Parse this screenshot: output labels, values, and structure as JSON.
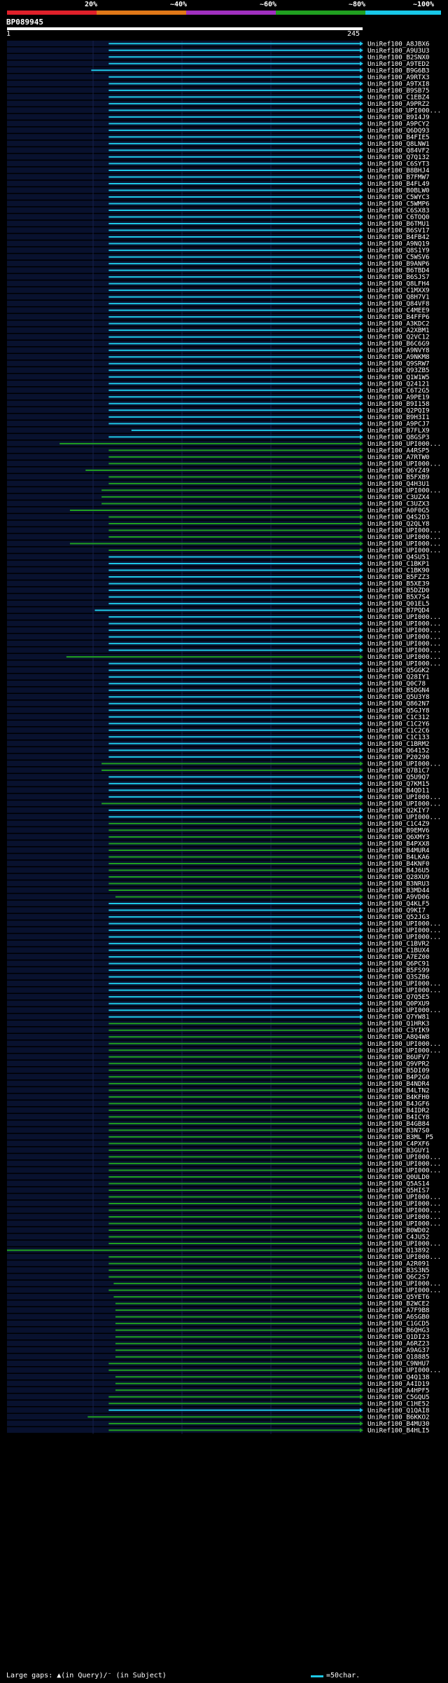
{
  "legend": {
    "labels": [
      "20%",
      "~40%",
      "~60%",
      "~80%",
      "~100%"
    ],
    "colors": [
      "#e0202a",
      "#e07818",
      "#a030c0",
      "#20a020",
      "#18c8e8"
    ]
  },
  "query": {
    "name": "BP089945",
    "start": "1",
    "end": "245"
  },
  "footer": {
    "gaps": "Large gaps: ▲(in Query)/⁻ (in Subject)",
    "key": "=50char."
  },
  "colors": {
    "cyan": "#1ec8e6",
    "green": "#20a020",
    "grid": "#16204a",
    "row": "#08112e"
  },
  "hits": [
    {
      "label": "UniRef100_A8JBX6",
      "color": "cyan",
      "start": 0.286
    },
    {
      "label": "UniRef100_A9U3U3",
      "color": "cyan",
      "start": 0.286
    },
    {
      "label": "UniRef100_B2SNX0",
      "color": "cyan",
      "start": 0.286
    },
    {
      "label": "UniRef100_A9TED2",
      "color": "cyan",
      "start": 0.286
    },
    {
      "label": "UniRef100_B9G6B3",
      "color": "cyan",
      "start": 0.237
    },
    {
      "label": "UniRef100_A9RTX3",
      "color": "cyan",
      "start": 0.286
    },
    {
      "label": "UniRef100_A9TXI8",
      "color": "cyan",
      "start": 0.286
    },
    {
      "label": "UniRef100_B9SB75",
      "color": "cyan",
      "start": 0.286
    },
    {
      "label": "UniRef100_C1EBZ4",
      "color": "cyan",
      "start": 0.286
    },
    {
      "label": "UniRef100_A9PRZ2",
      "color": "cyan",
      "start": 0.286
    },
    {
      "label": "UniRef100_UPI000...",
      "color": "cyan",
      "start": 0.286
    },
    {
      "label": "UniRef100_B9I4J9",
      "color": "cyan",
      "start": 0.286
    },
    {
      "label": "UniRef100_A9PCY2",
      "color": "cyan",
      "start": 0.286
    },
    {
      "label": "UniRef100_Q6DQ93",
      "color": "cyan",
      "start": 0.286
    },
    {
      "label": "UniRef100_B4FIE5",
      "color": "cyan",
      "start": 0.286
    },
    {
      "label": "UniRef100_Q8LNW1",
      "color": "cyan",
      "start": 0.286
    },
    {
      "label": "UniRef100_Q84VF2",
      "color": "cyan",
      "start": 0.286
    },
    {
      "label": "UniRef100_Q7Q132",
      "color": "cyan",
      "start": 0.286
    },
    {
      "label": "UniRef100_C6SYT3",
      "color": "cyan",
      "start": 0.286
    },
    {
      "label": "UniRef100_B8BHJ4",
      "color": "cyan",
      "start": 0.286
    },
    {
      "label": "UniRef100_B7FMW7",
      "color": "cyan",
      "start": 0.286
    },
    {
      "label": "UniRef100_B4FL49",
      "color": "cyan",
      "start": 0.286
    },
    {
      "label": "UniRef100_B0BLW0",
      "color": "cyan",
      "start": 0.286
    },
    {
      "label": "UniRef100_C5WYC3",
      "color": "cyan",
      "start": 0.286
    },
    {
      "label": "UniRef100_C5WMP6",
      "color": "cyan",
      "start": 0.286
    },
    {
      "label": "UniRef100_C6SX83",
      "color": "cyan",
      "start": 0.286
    },
    {
      "label": "UniRef100_C6TOQ0",
      "color": "cyan",
      "start": 0.286
    },
    {
      "label": "UniRef100_B6TMU1",
      "color": "cyan",
      "start": 0.286
    },
    {
      "label": "UniRef100_B6SV17",
      "color": "cyan",
      "start": 0.286
    },
    {
      "label": "UniRef100_B4FB42",
      "color": "cyan",
      "start": 0.286
    },
    {
      "label": "UniRef100_A9NQ19",
      "color": "cyan",
      "start": 0.286
    },
    {
      "label": "UniRef100_Q8S1Y9",
      "color": "cyan",
      "start": 0.286
    },
    {
      "label": "UniRef100_C5WSV6",
      "color": "cyan",
      "start": 0.286
    },
    {
      "label": "UniRef100_B9ANP6",
      "color": "cyan",
      "start": 0.286
    },
    {
      "label": "UniRef100_B6TBD4",
      "color": "cyan",
      "start": 0.286
    },
    {
      "label": "UniRef100_B6SJS7",
      "color": "cyan",
      "start": 0.286
    },
    {
      "label": "UniRef100_Q8LFH4",
      "color": "cyan",
      "start": 0.286
    },
    {
      "label": "UniRef100_C1MXX9",
      "color": "cyan",
      "start": 0.286
    },
    {
      "label": "UniRef100_Q8H7V1",
      "color": "cyan",
      "start": 0.286
    },
    {
      "label": "UniRef100_Q84VF8",
      "color": "cyan",
      "start": 0.286
    },
    {
      "label": "UniRef100_C4MEE9",
      "color": "cyan",
      "start": 0.286
    },
    {
      "label": "UniRef100_B4FFP6",
      "color": "cyan",
      "start": 0.286
    },
    {
      "label": "UniRef100_A3KDC2",
      "color": "cyan",
      "start": 0.286
    },
    {
      "label": "UniRef100_A2XBM1",
      "color": "cyan",
      "start": 0.286
    },
    {
      "label": "UniRef100_Q2VC12",
      "color": "cyan",
      "start": 0.286
    },
    {
      "label": "UniRef100_B6C6G9",
      "color": "cyan",
      "start": 0.286
    },
    {
      "label": "UniRef100_A9NVY8",
      "color": "cyan",
      "start": 0.286
    },
    {
      "label": "UniRef100_A9NKM8",
      "color": "cyan",
      "start": 0.286
    },
    {
      "label": "UniRef100_Q9SRW7",
      "color": "cyan",
      "start": 0.286
    },
    {
      "label": "UniRef100_Q93ZB5",
      "color": "cyan",
      "start": 0.286
    },
    {
      "label": "UniRef100_Q1W1W5",
      "color": "cyan",
      "start": 0.286
    },
    {
      "label": "UniRef100_Q24121",
      "color": "cyan",
      "start": 0.286
    },
    {
      "label": "UniRef100_C6T2G5",
      "color": "cyan",
      "start": 0.286
    },
    {
      "label": "UniRef100_A9PE19",
      "color": "cyan",
      "start": 0.286
    },
    {
      "label": "UniRef100_B9I158",
      "color": "cyan",
      "start": 0.286
    },
    {
      "label": "UniRef100_Q2PQI9",
      "color": "cyan",
      "start": 0.286
    },
    {
      "label": "UniRef100_B9H3I1",
      "color": "cyan",
      "start": 0.286
    },
    {
      "label": "UniRef100_A9PCJ7",
      "color": "cyan",
      "start": 0.286
    },
    {
      "label": "UniRef100_B7FLX9",
      "color": "cyan",
      "start": 0.35
    },
    {
      "label": "UniRef100_Q8GSP3",
      "color": "cyan",
      "start": 0.286
    },
    {
      "label": "UniRef100_UPI000...",
      "color": "green",
      "start": 0.148
    },
    {
      "label": "UniRef100_A4RSP5",
      "color": "green",
      "start": 0.286
    },
    {
      "label": "UniRef100_A7RTW0",
      "color": "green",
      "start": 0.286
    },
    {
      "label": "UniRef100_UPI000...",
      "color": "green",
      "start": 0.286
    },
    {
      "label": "UniRef100_Q6YZ49",
      "color": "green",
      "start": 0.221
    },
    {
      "label": "UniRef100_B5FXB9",
      "color": "green",
      "start": 0.286
    },
    {
      "label": "UniRef100_Q4H3U1",
      "color": "green",
      "start": 0.286
    },
    {
      "label": "UniRef100_UPI000...",
      "color": "green",
      "start": 0.266
    },
    {
      "label": "UniRef100_C3UZX4",
      "color": "green",
      "start": 0.266
    },
    {
      "label": "UniRef100_C3UZX3",
      "color": "green",
      "start": 0.266
    },
    {
      "label": "UniRef100_A0F0G5",
      "color": "green",
      "start": 0.177
    },
    {
      "label": "UniRef100_Q4S2D3",
      "color": "green",
      "start": 0.286
    },
    {
      "label": "UniRef100_Q2QLY8",
      "color": "green",
      "start": 0.286
    },
    {
      "label": "UniRef100_UPI000...",
      "color": "green",
      "start": 0.286
    },
    {
      "label": "UniRef100_UPI000...",
      "color": "green",
      "start": 0.286
    },
    {
      "label": "UniRef100_UPI000...",
      "color": "green",
      "start": 0.177
    },
    {
      "label": "UniRef100_UPI000...",
      "color": "green",
      "start": 0.286
    },
    {
      "label": "UniRef100_Q4SU51",
      "color": "cyan",
      "start": 0.286
    },
    {
      "label": "UniRef100_C1BKP1",
      "color": "cyan",
      "start": 0.286
    },
    {
      "label": "UniRef100_C1BK90",
      "color": "cyan",
      "start": 0.286
    },
    {
      "label": "UniRef100_B5FZZ3",
      "color": "cyan",
      "start": 0.286
    },
    {
      "label": "UniRef100_B5XE39",
      "color": "cyan",
      "start": 0.286
    },
    {
      "label": "UniRef100_B5DZD0",
      "color": "cyan",
      "start": 0.286
    },
    {
      "label": "UniRef100_B5X7S4",
      "color": "cyan",
      "start": 0.286
    },
    {
      "label": "UniRef100_Q01EL5",
      "color": "cyan",
      "start": 0.286
    },
    {
      "label": "UniRef100_B7PQD4",
      "color": "cyan",
      "start": 0.247
    },
    {
      "label": "UniRef100_UPI000...",
      "color": "cyan",
      "start": 0.286
    },
    {
      "label": "UniRef100_UPI000...",
      "color": "cyan",
      "start": 0.286
    },
    {
      "label": "UniRef100_UPI000...",
      "color": "cyan",
      "start": 0.286
    },
    {
      "label": "UniRef100_UPI000...",
      "color": "cyan",
      "start": 0.286
    },
    {
      "label": "UniRef100_UPI000...",
      "color": "cyan",
      "start": 0.286
    },
    {
      "label": "UniRef100_UPI000...",
      "color": "cyan",
      "start": 0.286
    },
    {
      "label": "UniRef100_UPI000...",
      "color": "green",
      "start": 0.167
    },
    {
      "label": "UniRef100_UPI000...",
      "color": "cyan",
      "start": 0.286
    },
    {
      "label": "UniRef100_Q5GGK2",
      "color": "cyan",
      "start": 0.286
    },
    {
      "label": "UniRef100_Q28IY1",
      "color": "cyan",
      "start": 0.286
    },
    {
      "label": "UniRef100_Q0C78",
      "color": "cyan",
      "start": 0.286
    },
    {
      "label": "UniRef100_B5DGN4",
      "color": "cyan",
      "start": 0.286
    },
    {
      "label": "UniRef100_Q5U3Y8",
      "color": "cyan",
      "start": 0.286
    },
    {
      "label": "UniRef100_Q862N7",
      "color": "cyan",
      "start": 0.286
    },
    {
      "label": "UniRef100_Q5GJY8",
      "color": "cyan",
      "start": 0.286
    },
    {
      "label": "UniRef100_C1C312",
      "color": "cyan",
      "start": 0.286
    },
    {
      "label": "UniRef100_C1C2Y6",
      "color": "cyan",
      "start": 0.286
    },
    {
      "label": "UniRef100_C1C2C6",
      "color": "cyan",
      "start": 0.286
    },
    {
      "label": "UniRef100_C1C133",
      "color": "cyan",
      "start": 0.286
    },
    {
      "label": "UniRef100_C1BRM2",
      "color": "cyan",
      "start": 0.286
    },
    {
      "label": "UniRef100_Q64152",
      "color": "cyan",
      "start": 0.286
    },
    {
      "label": "UniRef100_P20290",
      "color": "cyan",
      "start": 0.286
    },
    {
      "label": "UniRef100_UPI000...",
      "color": "green",
      "start": 0.266
    },
    {
      "label": "UniRef100_Q7B1C7",
      "color": "green",
      "start": 0.266
    },
    {
      "label": "UniRef100_Q5U9Q7",
      "color": "cyan",
      "start": 0.286
    },
    {
      "label": "UniRef100_Q7KM15",
      "color": "cyan",
      "start": 0.286
    },
    {
      "label": "UniRef100_B4QD11",
      "color": "cyan",
      "start": 0.286
    },
    {
      "label": "UniRef100_UPI000...",
      "color": "cyan",
      "start": 0.286
    },
    {
      "label": "UniRef100_UPI000...",
      "color": "green",
      "start": 0.266
    },
    {
      "label": "UniRef100_Q2KIY7",
      "color": "cyan",
      "start": 0.286
    },
    {
      "label": "UniRef100_UPI000...",
      "color": "cyan",
      "start": 0.286
    },
    {
      "label": "UniRef100_C1C4Z9",
      "color": "green",
      "start": 0.286
    },
    {
      "label": "UniRef100_B9EMV6",
      "color": "green",
      "start": 0.286
    },
    {
      "label": "UniRef100_Q6XMY3",
      "color": "green",
      "start": 0.286
    },
    {
      "label": "UniRef100_B4PXX8",
      "color": "green",
      "start": 0.286
    },
    {
      "label": "UniRef100_B4MUR4",
      "color": "green",
      "start": 0.286
    },
    {
      "label": "UniRef100_B4LKA6",
      "color": "green",
      "start": 0.286
    },
    {
      "label": "UniRef100_B4KNF0",
      "color": "green",
      "start": 0.286
    },
    {
      "label": "UniRef100_B4J6U5",
      "color": "green",
      "start": 0.286
    },
    {
      "label": "UniRef100_Q28XU9",
      "color": "green",
      "start": 0.286
    },
    {
      "label": "UniRef100_B3NRU3",
      "color": "green",
      "start": 0.286
    },
    {
      "label": "UniRef100_B3MD44",
      "color": "green",
      "start": 0.286
    },
    {
      "label": "UniRef100_A9VD06",
      "color": "green",
      "start": 0.305
    },
    {
      "label": "UniRef100_Q4KLF5",
      "color": "cyan",
      "start": 0.286
    },
    {
      "label": "UniRef100_Q9KI7",
      "color": "cyan",
      "start": 0.286
    },
    {
      "label": "UniRef100_Q52JG3",
      "color": "cyan",
      "start": 0.286
    },
    {
      "label": "UniRef100_UPI000...",
      "color": "cyan",
      "start": 0.286
    },
    {
      "label": "UniRef100_UPI000...",
      "color": "cyan",
      "start": 0.286
    },
    {
      "label": "UniRef100_UPI000...",
      "color": "cyan",
      "start": 0.286
    },
    {
      "label": "UniRef100_C1BVR2",
      "color": "cyan",
      "start": 0.286
    },
    {
      "label": "UniRef100_C1BUX4",
      "color": "cyan",
      "start": 0.286
    },
    {
      "label": "UniRef100_A7EZ00",
      "color": "cyan",
      "start": 0.286
    },
    {
      "label": "UniRef100_Q6PC91",
      "color": "cyan",
      "start": 0.286
    },
    {
      "label": "UniRef100_B5FS99",
      "color": "cyan",
      "start": 0.286
    },
    {
      "label": "UniRef100_Q3SZB6",
      "color": "cyan",
      "start": 0.286
    },
    {
      "label": "UniRef100_UPI000...",
      "color": "cyan",
      "start": 0.286
    },
    {
      "label": "UniRef100_UPI000...",
      "color": "cyan",
      "start": 0.286
    },
    {
      "label": "UniRef100_Q7Q5E5",
      "color": "cyan",
      "start": 0.286
    },
    {
      "label": "UniRef100_Q0PXU9",
      "color": "cyan",
      "start": 0.286
    },
    {
      "label": "UniRef100_UPI000...",
      "color": "cyan",
      "start": 0.286
    },
    {
      "label": "UniRef100_Q7YW81",
      "color": "cyan",
      "start": 0.286
    },
    {
      "label": "UniRef100_Q1HRK3",
      "color": "green",
      "start": 0.286
    },
    {
      "label": "UniRef100_C3YIK9",
      "color": "green",
      "start": 0.286
    },
    {
      "label": "UniRef100_A8Q4W8",
      "color": "green",
      "start": 0.286
    },
    {
      "label": "UniRef100_UPI000...",
      "color": "green",
      "start": 0.286
    },
    {
      "label": "UniRef100_UPI000...",
      "color": "green",
      "start": 0.286
    },
    {
      "label": "UniRef100_B6UFV7",
      "color": "green",
      "start": 0.286
    },
    {
      "label": "UniRef100_Q9VPR2",
      "color": "green",
      "start": 0.286
    },
    {
      "label": "UniRef100_B5DI09",
      "color": "green",
      "start": 0.286
    },
    {
      "label": "UniRef100_B4P2G0",
      "color": "green",
      "start": 0.286
    },
    {
      "label": "UniRef100_B4NDR4",
      "color": "green",
      "start": 0.286
    },
    {
      "label": "UniRef100_B4LTN2",
      "color": "green",
      "start": 0.286
    },
    {
      "label": "UniRef100_B4KFH0",
      "color": "green",
      "start": 0.286
    },
    {
      "label": "UniRef100_B4JGF6",
      "color": "green",
      "start": 0.286
    },
    {
      "label": "UniRef100_B4IDR2",
      "color": "green",
      "start": 0.286
    },
    {
      "label": "UniRef100_B4ICY8",
      "color": "green",
      "start": 0.286
    },
    {
      "label": "UniRef100_B4GB84",
      "color": "green",
      "start": 0.286
    },
    {
      "label": "UniRef100_B3N7S0",
      "color": "green",
      "start": 0.286
    },
    {
      "label": "UniRef100_B3ML P5",
      "color": "green",
      "start": 0.286
    },
    {
      "label": "UniRef100_C4PXF6",
      "color": "green",
      "start": 0.286
    },
    {
      "label": "UniRef100_B3GUY1",
      "color": "green",
      "start": 0.286
    },
    {
      "label": "UniRef100_UPI000...",
      "color": "green",
      "start": 0.286
    },
    {
      "label": "UniRef100_UPI000...",
      "color": "green",
      "start": 0.286
    },
    {
      "label": "UniRef100_UPI000...",
      "color": "green",
      "start": 0.286
    },
    {
      "label": "UniRef100_Q0ULD0",
      "color": "green",
      "start": 0.286
    },
    {
      "label": "UniRef100_Q5AS14",
      "color": "green",
      "start": 0.286
    },
    {
      "label": "UniRef100_Q5HIS7",
      "color": "green",
      "start": 0.286
    },
    {
      "label": "UniRef100_UPI000...",
      "color": "green",
      "start": 0.286
    },
    {
      "label": "UniRef100_UPI000...",
      "color": "green",
      "start": 0.286
    },
    {
      "label": "UniRef100_UPI000...",
      "color": "green",
      "start": 0.286
    },
    {
      "label": "UniRef100_UPI000...",
      "color": "green",
      "start": 0.286
    },
    {
      "label": "UniRef100_UPI000...",
      "color": "green",
      "start": 0.286
    },
    {
      "label": "UniRef100_B0WD02",
      "color": "green",
      "start": 0.286
    },
    {
      "label": "UniRef100_C4JU52",
      "color": "green",
      "start": 0.286
    },
    {
      "label": "UniRef100_UPI000...",
      "color": "green",
      "start": 0.286
    },
    {
      "label": "UniRef100_Q13892",
      "color": "green",
      "start": 0.0
    },
    {
      "label": "UniRef100_UPI000...",
      "color": "green",
      "start": 0.286
    },
    {
      "label": "UniRef100_A2R091",
      "color": "green",
      "start": 0.286
    },
    {
      "label": "UniRef100_B3S3N5",
      "color": "green",
      "start": 0.286
    },
    {
      "label": "UniRef100_Q6C2S7",
      "color": "green",
      "start": 0.286
    },
    {
      "label": "UniRef100_UPI000...",
      "color": "green",
      "start": 0.3
    },
    {
      "label": "UniRef100_UPI000...",
      "color": "green",
      "start": 0.286
    },
    {
      "label": "UniRef100_Q5YET6",
      "color": "green",
      "start": 0.3
    },
    {
      "label": "UniRef100_B2WCE2",
      "color": "green",
      "start": 0.305
    },
    {
      "label": "UniRef100_A7F9B8",
      "color": "green",
      "start": 0.305
    },
    {
      "label": "UniRef100_A6SGB0",
      "color": "green",
      "start": 0.305
    },
    {
      "label": "UniRef100_C1GCD5",
      "color": "green",
      "start": 0.305
    },
    {
      "label": "UniRef100_B6QHG3",
      "color": "green",
      "start": 0.305
    },
    {
      "label": "UniRef100_Q1DI23",
      "color": "green",
      "start": 0.305
    },
    {
      "label": "UniRef100_A6RZ23",
      "color": "green",
      "start": 0.305
    },
    {
      "label": "UniRef100_A9AG37",
      "color": "green",
      "start": 0.305
    },
    {
      "label": "UniRef100_Q18885",
      "color": "green",
      "start": 0.305
    },
    {
      "label": "UniRef100_C9NHU7",
      "color": "green",
      "start": 0.286
    },
    {
      "label": "UniRef100_UPI000...",
      "color": "green",
      "start": 0.286
    },
    {
      "label": "UniRef100_Q4Q138",
      "color": "green",
      "start": 0.305
    },
    {
      "label": "UniRef100_A4ID19",
      "color": "green",
      "start": 0.305
    },
    {
      "label": "UniRef100_A4HPF5",
      "color": "green",
      "start": 0.305
    },
    {
      "label": "UniRef100_C5GQU5",
      "color": "green",
      "start": 0.286
    },
    {
      "label": "UniRef100_C1HE52",
      "color": "green",
      "start": 0.286
    },
    {
      "label": "UniRef100_Q1QAI8",
      "color": "cyan",
      "start": 0.286
    },
    {
      "label": "UniRef100_B6KKO2",
      "color": "green",
      "start": 0.227
    },
    {
      "label": "UniRef100_B4MU30",
      "color": "green",
      "start": 0.286
    },
    {
      "label": "UniRef100_B4HLI5",
      "color": "green",
      "start": 0.286
    }
  ]
}
